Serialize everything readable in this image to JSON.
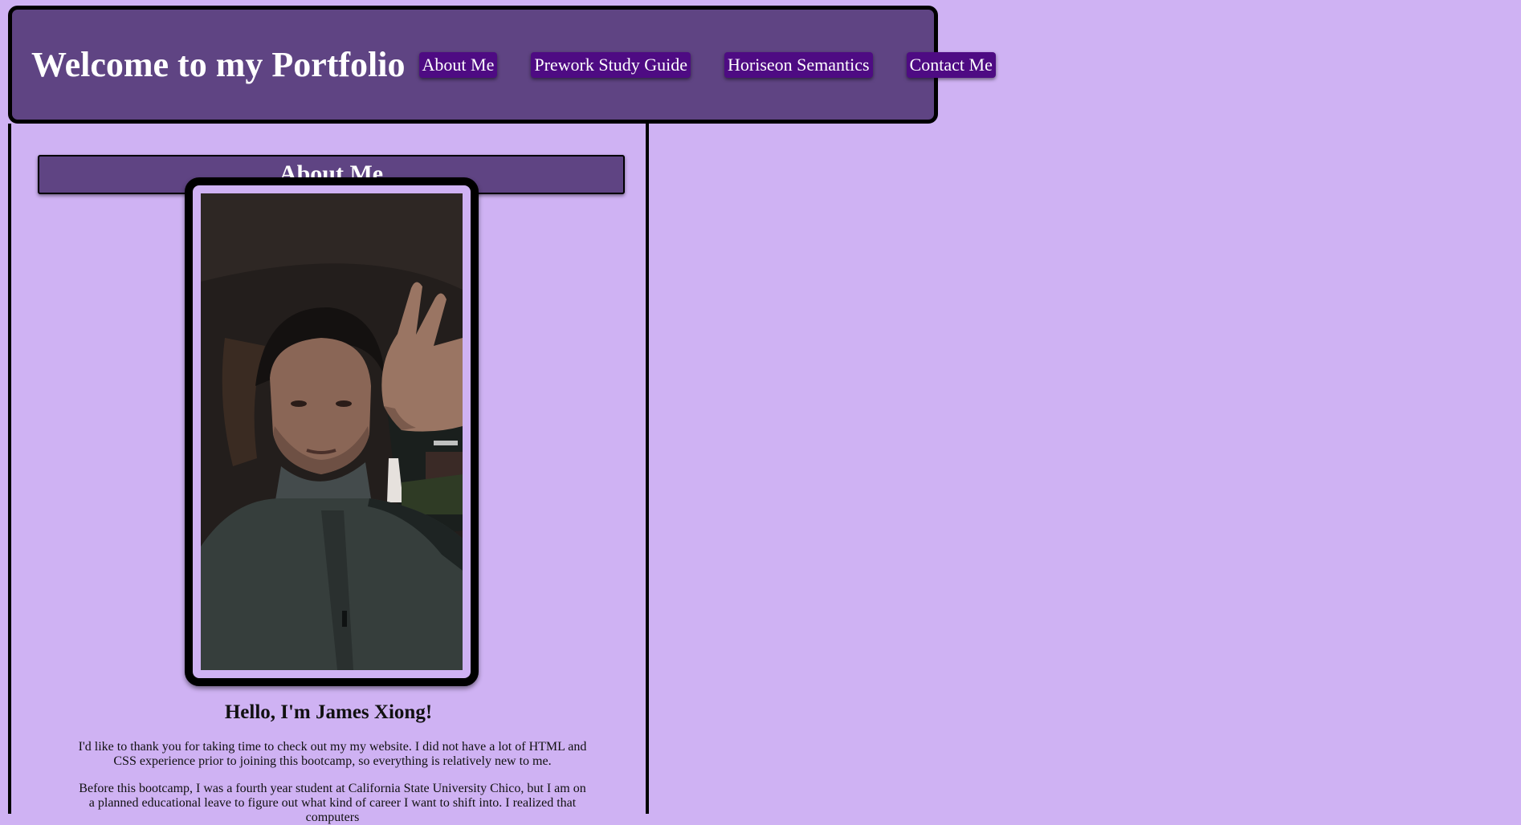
{
  "header": {
    "title": "Welcome to my Portfolio",
    "nav": [
      {
        "label": "About Me"
      },
      {
        "label": "Prework Study Guide"
      },
      {
        "label": "Horiseon Semantics"
      },
      {
        "label": "Contact Me"
      }
    ]
  },
  "about": {
    "heading": "About Me",
    "photo_alt": "Selfie of James Xiong",
    "greeting": "Hello, I'm James Xiong!",
    "paragraphs": [
      "I'd like to thank you for taking time to check out my my website. I did not have a lot of HTML and CSS experience prior to joining this bootcamp, so everything is relatively new to me.",
      "Before this bootcamp, I was a fourth year student at California State University Chico, but I am on a planned educational leave to figure out what kind of career I want to shift into. I realized that computers"
    ]
  },
  "colors": {
    "page_background": "#cfb2f3",
    "header_background": "#5f4483",
    "nav_button": "#4e0b83"
  }
}
